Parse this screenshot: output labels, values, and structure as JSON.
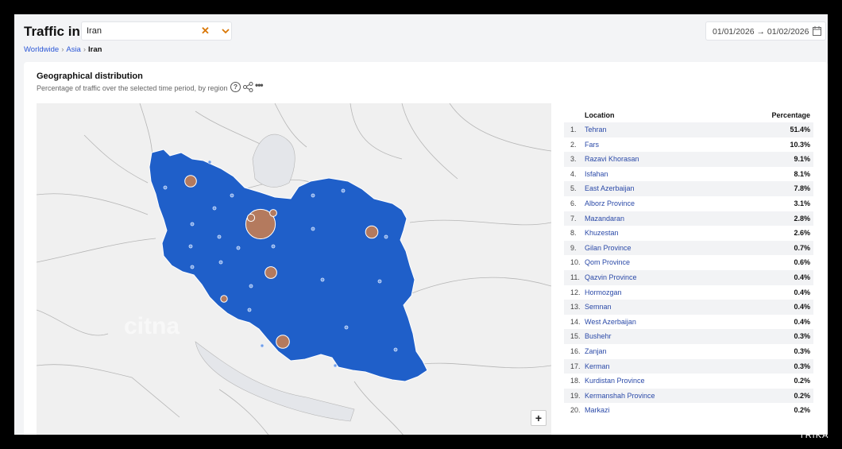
{
  "header": {
    "title": "Traffic in",
    "location_value": "Iran",
    "date_range": "01/01/2026 → 01/02/2026"
  },
  "breadcrumb": {
    "items": [
      "Worldwide",
      "Asia"
    ],
    "current": "Iran"
  },
  "card": {
    "title": "Geographical distribution",
    "subtitle": "Percentage of traffic over the selected time period, by region",
    "help": "?",
    "more": "•••"
  },
  "map": {
    "zoom_in_label": "+",
    "highlight_color": "#1f5fc9",
    "bubble_color": "#b47a5e"
  },
  "table": {
    "col_location": "Location",
    "col_percentage": "Percentage",
    "rows": [
      {
        "rank": "1.",
        "name": "Tehran",
        "pct": "51.4%"
      },
      {
        "rank": "2.",
        "name": "Fars",
        "pct": "10.3%"
      },
      {
        "rank": "3.",
        "name": "Razavi Khorasan",
        "pct": "9.1%"
      },
      {
        "rank": "4.",
        "name": "Isfahan",
        "pct": "8.1%"
      },
      {
        "rank": "5.",
        "name": "East Azerbaijan",
        "pct": "7.8%"
      },
      {
        "rank": "6.",
        "name": "Alborz Province",
        "pct": "3.1%"
      },
      {
        "rank": "7.",
        "name": "Mazandaran",
        "pct": "2.8%"
      },
      {
        "rank": "8.",
        "name": "Khuzestan",
        "pct": "2.6%"
      },
      {
        "rank": "9.",
        "name": "Gilan Province",
        "pct": "0.7%"
      },
      {
        "rank": "10.",
        "name": "Qom Province",
        "pct": "0.6%"
      },
      {
        "rank": "11.",
        "name": "Qazvin Province",
        "pct": "0.4%"
      },
      {
        "rank": "12.",
        "name": "Hormozgan",
        "pct": "0.4%"
      },
      {
        "rank": "13.",
        "name": "Semnan",
        "pct": "0.4%"
      },
      {
        "rank": "14.",
        "name": "West Azerbaijan",
        "pct": "0.4%"
      },
      {
        "rank": "15.",
        "name": "Bushehr",
        "pct": "0.3%"
      },
      {
        "rank": "16.",
        "name": "Zanjan",
        "pct": "0.3%"
      },
      {
        "rank": "17.",
        "name": "Kerman",
        "pct": "0.3%"
      },
      {
        "rank": "18.",
        "name": "Kurdistan Province",
        "pct": "0.2%"
      },
      {
        "rank": "19.",
        "name": "Kermanshah Province",
        "pct": "0.2%"
      },
      {
        "rank": "20.",
        "name": "Markazi",
        "pct": "0.2%"
      }
    ]
  },
  "watermark": "TRIKA"
}
